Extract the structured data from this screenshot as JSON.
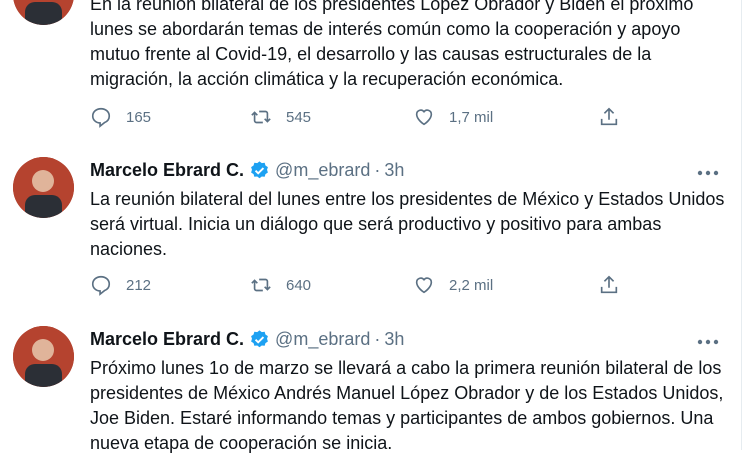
{
  "tweets": [
    {
      "text": "En la reunión bilateral de los presidentes López Obrador y Biden el próximo lunes se abordarán temas de interés común como la cooperación y apoyo mutuo frente al Covid-19, el desarrollo y las causas estructurales de la migración, la acción climática y la recuperación económica.",
      "replies": "165",
      "retweets": "545",
      "likes": "1,7 mil"
    },
    {
      "name": "Marcelo Ebrard C.",
      "handle": "@m_ebrard",
      "separator": "·",
      "time": "3h",
      "text": "La reunión bilateral del lunes entre los presidentes de México y Estados Unidos será virtual. Inicia un diálogo que será productivo y positivo para ambas naciones.",
      "replies": "212",
      "retweets": "640",
      "likes": "2,2 mil"
    },
    {
      "name": "Marcelo Ebrard C.",
      "handle": "@m_ebrard",
      "separator": "·",
      "time": "3h",
      "text": "Próximo lunes 1o de marzo se llevará a cabo la primera reunión bilateral de los presidentes de México Andrés Manuel López Obrador y de los Estados Unidos, Joe Biden. Estaré informando temas y participantes de ambos gobiernos. Una nueva etapa de cooperación se inicia."
    }
  ],
  "icons": {
    "reply": "reply-icon",
    "retweet": "retweet-icon",
    "like": "heart-icon",
    "share": "share-icon",
    "verified": "verified-badge-icon",
    "more": "more-options-icon"
  },
  "colors": {
    "verified": "#1da1f2",
    "secondary_text": "#5b7083",
    "divider": "#e6ecf0"
  }
}
